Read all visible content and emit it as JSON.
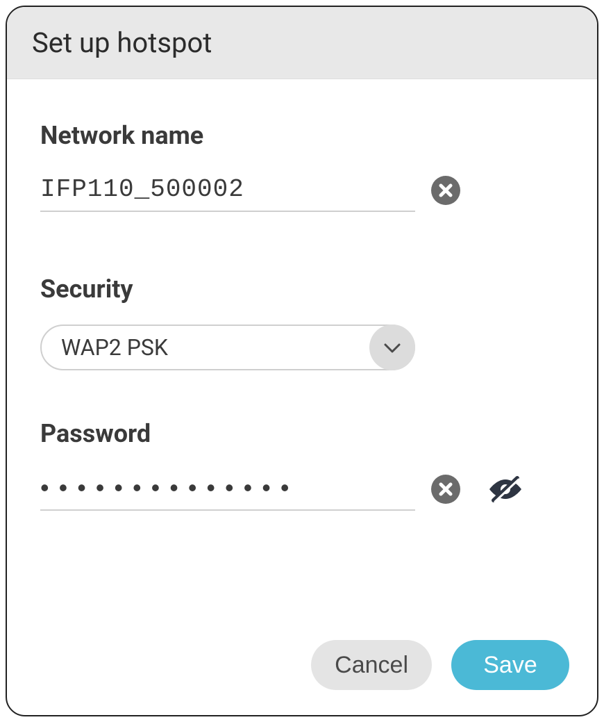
{
  "dialog": {
    "title": "Set up hotspot"
  },
  "network": {
    "label": "Network name",
    "value": "IFP110_500002"
  },
  "security": {
    "label": "Security",
    "selected": "WAP2 PSK"
  },
  "password": {
    "label": "Password",
    "masked": "••••••••••••••"
  },
  "actions": {
    "cancel": "Cancel",
    "save": "Save"
  }
}
